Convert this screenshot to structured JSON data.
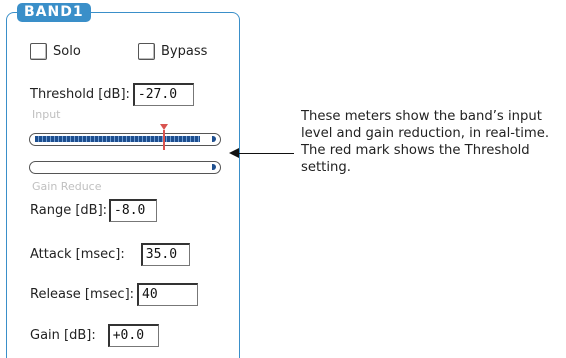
{
  "band": {
    "title": "BAND1"
  },
  "solo": {
    "label": "Solo"
  },
  "bypass": {
    "label": "Bypass"
  },
  "threshold": {
    "label": "Threshold [dB]",
    "value": "-27.0"
  },
  "meters": {
    "input_label": "Input",
    "gain_reduce_label": "Gain Reduce",
    "input_level": 0.94,
    "gain_reduce_level": 0.0
  },
  "range": {
    "label": "Range [dB]",
    "value": "-8.0"
  },
  "attack": {
    "label": "Attack [msec]",
    "value": "35.0"
  },
  "release": {
    "label": "Release [msec]",
    "value": "40"
  },
  "gain": {
    "label": "Gain [dB]",
    "value": "+0.0"
  },
  "callout": {
    "text": "These meters show the band’s input level and gain reduction, in real-time. The red mark shows the Threshold setting."
  },
  "colors": {
    "accent": "#3a8fc9",
    "threshold_mark": "#d9534f",
    "meter_fill": "#1e4f8f"
  }
}
